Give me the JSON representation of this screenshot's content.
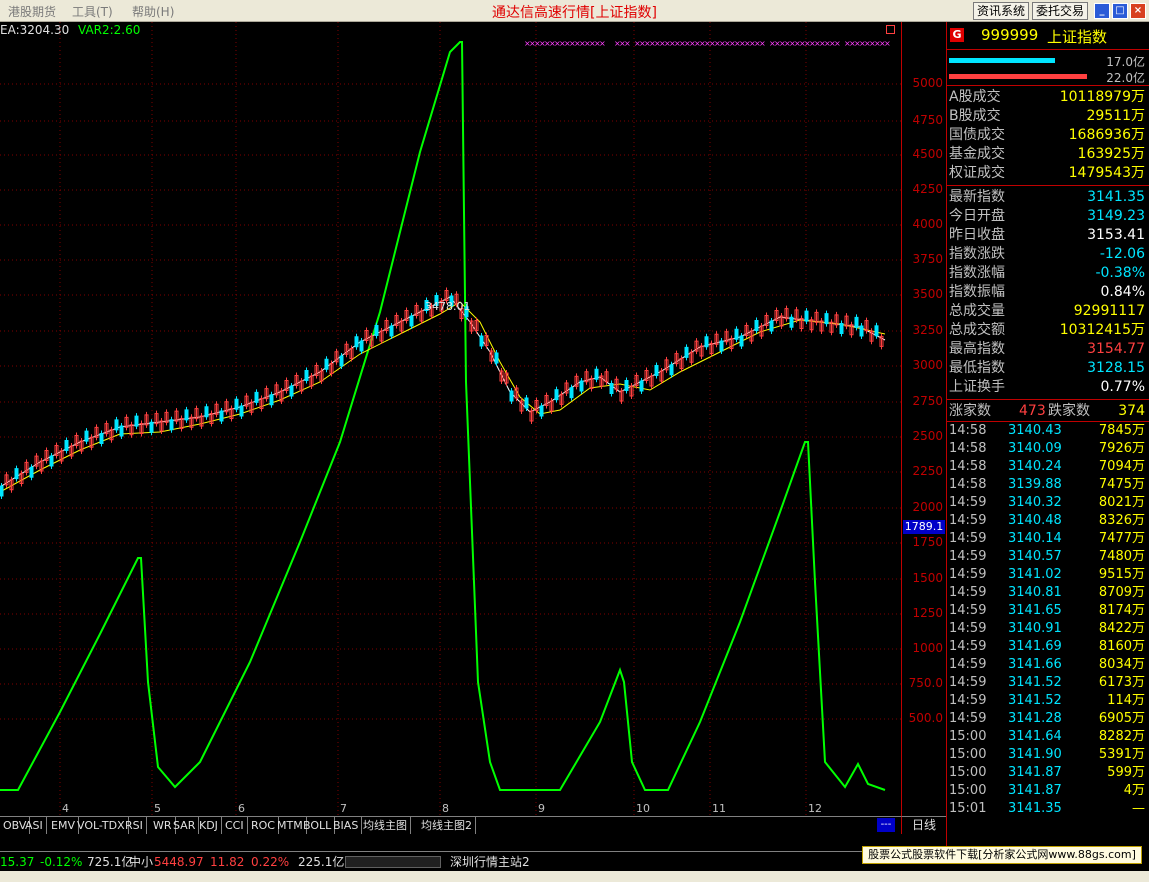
{
  "menu": [
    "港股期货",
    "工具(T)",
    "帮助(H)"
  ],
  "window_title": "通达信高速行情[上证指数]",
  "toolbar": {
    "news": "资讯系统",
    "trade": "委托交易"
  },
  "indicator": {
    "ema": "EA:3204.30",
    "var2": "VAR2:2.60"
  },
  "annotation": "3478.01",
  "price_tag": "1789.1",
  "y_axis_ticks": [
    "5000",
    "4750",
    "4500",
    "4250",
    "4000",
    "3750",
    "3500",
    "3250",
    "3000",
    "2750",
    "2500",
    "2250",
    "2000",
    "1750",
    "1500",
    "1250",
    "1000",
    "750.0",
    "500.0"
  ],
  "x_axis_ticks": [
    "4",
    "5",
    "6",
    "7",
    "8",
    "9",
    "10",
    "11",
    "12"
  ],
  "stock": {
    "badge": "G",
    "code": "999999",
    "name": "上证指数"
  },
  "volume_bars": [
    {
      "label": "17.0亿",
      "color": "#00e5ff"
    },
    {
      "label": "22.0亿",
      "color": "#ff4040"
    }
  ],
  "stats1": [
    {
      "label": "A股成交",
      "value": "10118979万",
      "color": "#ffff00"
    },
    {
      "label": "B股成交",
      "value": "29511万",
      "color": "#ffff00"
    },
    {
      "label": "国债成交",
      "value": "1686936万",
      "color": "#ffff00"
    },
    {
      "label": "基金成交",
      "value": "163925万",
      "color": "#ffff00"
    },
    {
      "label": "权证成交",
      "value": "1479543万",
      "color": "#ffff00"
    }
  ],
  "stats2": [
    {
      "label": "最新指数",
      "value": "3141.35",
      "color": "#00e5ff"
    },
    {
      "label": "今日开盘",
      "value": "3149.23",
      "color": "#00e5ff"
    },
    {
      "label": "昨日收盘",
      "value": "3153.41",
      "color": "#ffffff"
    },
    {
      "label": "指数涨跌",
      "value": "-12.06",
      "color": "#00e5ff"
    },
    {
      "label": "指数涨幅",
      "value": "-0.38%",
      "color": "#00e5ff"
    },
    {
      "label": "指数振幅",
      "value": "0.84%",
      "color": "#ffffff"
    },
    {
      "label": "总成交量",
      "value": "92991117",
      "color": "#ffff00"
    },
    {
      "label": "总成交额",
      "value": "10312415万",
      "color": "#ffff00"
    },
    {
      "label": "最高指数",
      "value": "3154.77",
      "color": "#ff4040"
    },
    {
      "label": "最低指数",
      "value": "3128.15",
      "color": "#00e5ff"
    },
    {
      "label": "上证换手",
      "value": "0.77%",
      "color": "#ffffff"
    }
  ],
  "advance_decline": {
    "up_label": "涨家数",
    "up": "473",
    "down_label": "跌家数",
    "down": "374"
  },
  "ticks": [
    {
      "t": "14:58",
      "p": "3140.43",
      "v": "7845万"
    },
    {
      "t": "14:58",
      "p": "3140.09",
      "v": "7926万"
    },
    {
      "t": "14:58",
      "p": "3140.24",
      "v": "7094万"
    },
    {
      "t": "14:58",
      "p": "3139.88",
      "v": "7475万"
    },
    {
      "t": "14:59",
      "p": "3140.32",
      "v": "8021万"
    },
    {
      "t": "14:59",
      "p": "3140.48",
      "v": "8326万"
    },
    {
      "t": "14:59",
      "p": "3140.14",
      "v": "7477万"
    },
    {
      "t": "14:59",
      "p": "3140.57",
      "v": "7480万"
    },
    {
      "t": "14:59",
      "p": "3141.02",
      "v": "9515万"
    },
    {
      "t": "14:59",
      "p": "3140.81",
      "v": "8709万"
    },
    {
      "t": "14:59",
      "p": "3141.65",
      "v": "8174万"
    },
    {
      "t": "14:59",
      "p": "3140.91",
      "v": "8422万"
    },
    {
      "t": "14:59",
      "p": "3141.69",
      "v": "8160万"
    },
    {
      "t": "14:59",
      "p": "3141.66",
      "v": "8034万"
    },
    {
      "t": "14:59",
      "p": "3141.52",
      "v": "6173万"
    },
    {
      "t": "14:59",
      "p": "3141.52",
      "v": "114万"
    },
    {
      "t": "14:59",
      "p": "3141.28",
      "v": "6905万"
    },
    {
      "t": "15:00",
      "p": "3141.64",
      "v": "8282万"
    },
    {
      "t": "15:00",
      "p": "3141.90",
      "v": "5391万"
    },
    {
      "t": "15:00",
      "p": "3141.87",
      "v": "599万"
    },
    {
      "t": "15:00",
      "p": "3141.87",
      "v": "4万"
    },
    {
      "t": "15:01",
      "p": "3141.35",
      "v": "—"
    }
  ],
  "tabs": [
    "OBV",
    "ASI",
    "EMV",
    "VOL-TDX",
    "RSI",
    "WR",
    "SAR",
    "KDJ",
    "CCI",
    "ROC",
    "MTM",
    "BOLL",
    "BIAS",
    "均线主图",
    "均线主图2"
  ],
  "dayline": "日线",
  "more": "---",
  "status": {
    "val1": "15.37",
    "pct1": "-0.12%",
    "amt1": "725.1亿",
    "name2": "中小",
    "val2": "5448.97",
    "chg2": "11.82",
    "pct2": "0.22%",
    "amt2": "225.1亿",
    "server": "深圳行情主站2"
  },
  "ad": "股票公式股票软件下载[分析家公式网www.88gs.com]",
  "colors": {
    "up": "#ff4040",
    "down": "#00e5ff",
    "line": "#00ff00",
    "grid": "#800000"
  }
}
